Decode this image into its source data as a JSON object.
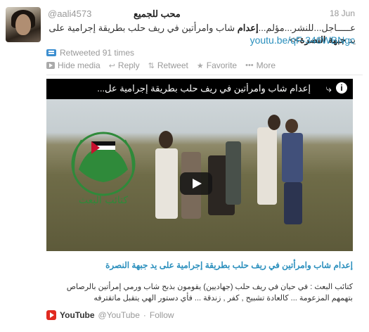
{
  "tweet": {
    "author_name": "محب للجميع",
    "handle": "@aali4573",
    "date": "18 Jun",
    "text_part1": "عـــــاجل...للنشر...مؤلم...",
    "text_bold1": "إعدام",
    "text_part2": " شاب وامرأتين في ريف حلب بطريقة إجرامية على يد ",
    "text_bold2": "جبهة النصرة",
    "text_part3": ">>",
    "link": "youtu.be/qF-346WBNgc",
    "retweeted": "Retweeted 91 times"
  },
  "actions": {
    "hide_media": "Hide media",
    "reply": "Reply",
    "retweet": "Retweet",
    "favorite": "Favorite",
    "more": "More"
  },
  "video": {
    "title": "إعدام شاب وامرأتين في ريف حلب بطريقة إجرامية عل...",
    "emblem_text": "كتائب البعث"
  },
  "card": {
    "link_title": "إعدام شاب وامرأتين في ريف حلب بطريقة إجرامية على يد جبهة النصرة",
    "description": "كتائب البعث : في حيان في ريف حلب (جهاديين) يقومون بذبح شاب ورمي إمرأتين بالرصاص بتهمهم المزعومة ... كالعادة تشبيح , كفر , زندقة ... فأي دستور الهي يتقبل ماتقترفه",
    "source_name": "YouTube",
    "source_handle": "@YouTube",
    "follow": "Follow"
  }
}
